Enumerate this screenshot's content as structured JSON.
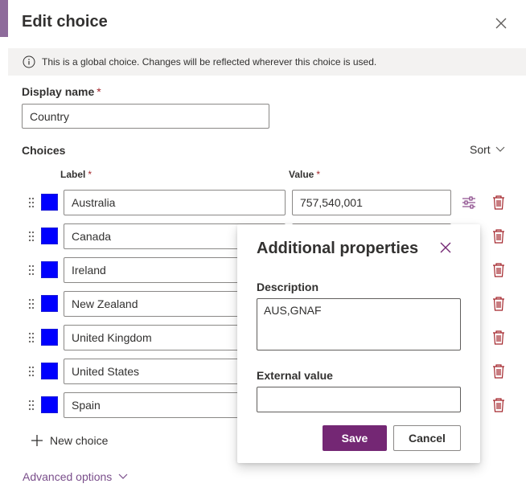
{
  "panel": {
    "title": "Edit choice"
  },
  "banner": {
    "text": "This is a global choice. Changes will be reflected wherever this choice is used."
  },
  "display_name": {
    "label": "Display name",
    "required_marker": "*",
    "value": "Country"
  },
  "choices": {
    "title": "Choices",
    "sort_label": "Sort",
    "label_header": "Label",
    "value_header": "Value",
    "required_marker": "*",
    "swatch_color": "#0000ff",
    "items": [
      {
        "label": "Australia",
        "value": "757,540,001"
      },
      {
        "label": "Canada",
        "value": ""
      },
      {
        "label": "Ireland",
        "value": ""
      },
      {
        "label": "New Zealand",
        "value": ""
      },
      {
        "label": "United Kingdom",
        "value": ""
      },
      {
        "label": "United States",
        "value": ""
      },
      {
        "label": "Spain",
        "value": ""
      }
    ],
    "new_choice_label": "New choice"
  },
  "advanced": {
    "label": "Advanced options"
  },
  "additional_properties": {
    "title": "Additional properties",
    "description_label": "Description",
    "description_value": "AUS,GNAF",
    "external_value_label": "External value",
    "external_value": "",
    "save_label": "Save",
    "cancel_label": "Cancel"
  },
  "colors": {
    "accent": "#742774",
    "link": "#7a4e8b",
    "delete_icon": "#a4262c"
  }
}
